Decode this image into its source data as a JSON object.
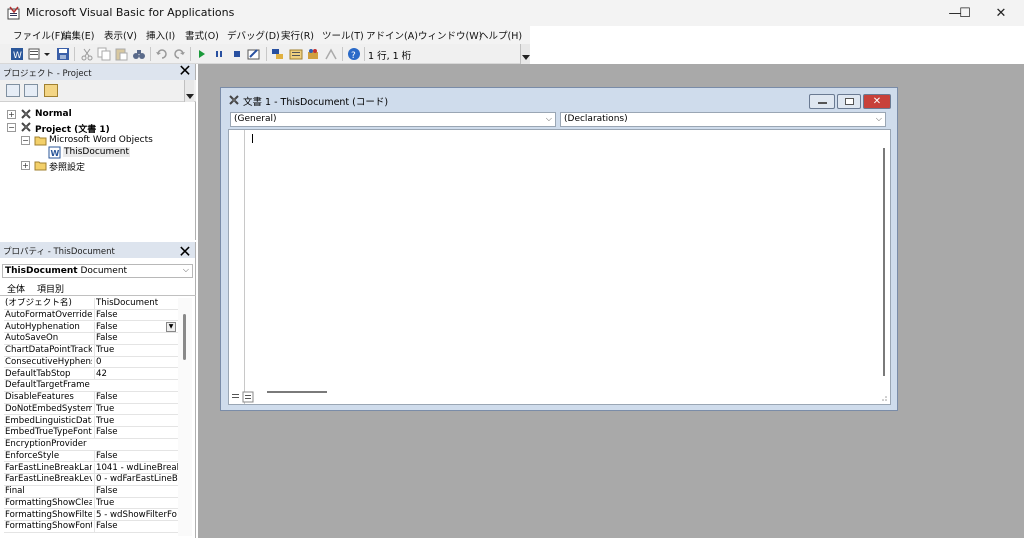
{
  "window": {
    "title": "Microsoft Visual Basic for Applications",
    "controls": {
      "minimize": "—",
      "maximize": "☐",
      "close": "✕"
    }
  },
  "menu": {
    "items": [
      "ファイル(F)",
      "編集(E)",
      "表示(V)",
      "挿入(I)",
      "書式(O)",
      "デバッグ(D)",
      "実行(R)",
      "ツール(T)",
      "アドイン(A)",
      "ウィンドウ(W)",
      "ヘルプ(H)"
    ]
  },
  "toolbar": {
    "position_text": "1 行, 1 桁",
    "icons": [
      "view-word-icon",
      "insert-module-icon",
      "save-icon",
      "cut-icon",
      "copy-icon",
      "paste-icon",
      "find-icon",
      "undo-icon",
      "redo-icon",
      "run-icon",
      "break-icon",
      "reset-icon",
      "design-mode-icon",
      "project-explorer-icon",
      "properties-icon",
      "object-browser-icon",
      "toolbox-icon",
      "help-icon"
    ]
  },
  "project_pane": {
    "title": "プロジェクト - Project",
    "tree": {
      "normal": "Normal",
      "project": "Project (文書 1)",
      "word_objects": "Microsoft Word Objects",
      "this_document": "ThisDocument",
      "references": "参照設定"
    }
  },
  "properties_pane": {
    "title": "プロパティ - ThisDocument",
    "object_name": "ThisDocument",
    "object_type": "Document",
    "tabs": [
      "全体",
      "項目別"
    ],
    "rows": [
      [
        "(オブジェクト名)",
        "ThisDocument"
      ],
      [
        "AutoFormatOverride",
        "False"
      ],
      [
        "AutoHyphenation",
        "False"
      ],
      [
        "AutoSaveOn",
        "False"
      ],
      [
        "ChartDataPointTrack",
        "True"
      ],
      [
        "ConsecutiveHyphens",
        "0"
      ],
      [
        "DefaultTabStop",
        "42"
      ],
      [
        "DefaultTargetFrame",
        ""
      ],
      [
        "DisableFeatures",
        "False"
      ],
      [
        "DoNotEmbedSystemF",
        "True"
      ],
      [
        "EmbedLinguisticData",
        "True"
      ],
      [
        "EmbedTrueTypeFonts",
        "False"
      ],
      [
        "EncryptionProvider",
        ""
      ],
      [
        "EnforceStyle",
        "False"
      ],
      [
        "FarEastLineBreakLan",
        "1041 - wdLineBreal"
      ],
      [
        "FarEastLineBreakLev",
        "0 - wdFarEastLineB"
      ],
      [
        "Final",
        "False"
      ],
      [
        "FormattingShowClear",
        "True"
      ],
      [
        "FormattingShowFilter",
        "5 - wdShowFilterFo"
      ],
      [
        "FormattingShowFont",
        "False"
      ]
    ]
  },
  "code_window": {
    "title": "文書 1 - ThisDocument (コード)",
    "object_combo": "(General)",
    "procedure_combo": "(Declarations)"
  },
  "colors": {
    "accent_blue": "#dde4ee",
    "mdi_background": "#a9a9a9",
    "code_frame": "#cfdcec",
    "close_red": "#c8413a"
  }
}
